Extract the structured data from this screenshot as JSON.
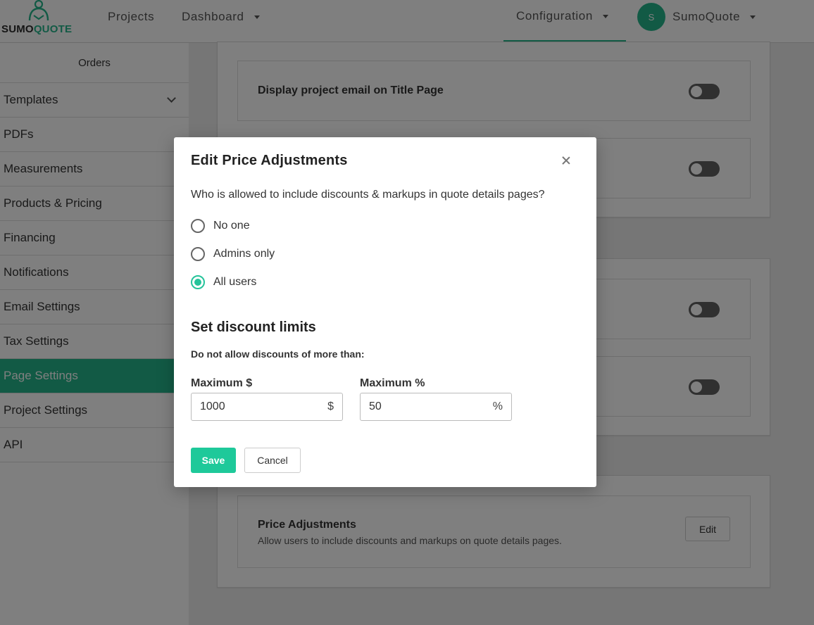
{
  "brand": {
    "name_part1": "SUMO",
    "name_part2": "QUOTE",
    "accent_color": "#25b48a"
  },
  "nav": {
    "projects": "Projects",
    "dashboard": "Dashboard",
    "configuration": "Configuration",
    "avatar_initial": "S",
    "account": "SumoQuote"
  },
  "sidebar": {
    "header": "Orders",
    "items": [
      {
        "label": "Templates",
        "expandable": true
      },
      {
        "label": "PDFs"
      },
      {
        "label": "Measurements"
      },
      {
        "label": "Products & Pricing"
      },
      {
        "label": "Financing"
      },
      {
        "label": "Notifications"
      },
      {
        "label": "Email Settings"
      },
      {
        "label": "Tax Settings"
      },
      {
        "label": "Page Settings",
        "active": true
      },
      {
        "label": "Project Settings"
      },
      {
        "label": "API"
      }
    ]
  },
  "main": {
    "cards": [
      {
        "title": "Display project email on Title Page",
        "toggle": false
      }
    ],
    "price_adjustments": {
      "title": "Price Adjustments",
      "description": "Allow users to include discounts and markups on quote details pages.",
      "edit_label": "Edit"
    }
  },
  "modal": {
    "title": "Edit Price Adjustments",
    "question": "Who is allowed to include discounts & markups in quote details pages?",
    "options": [
      {
        "label": "No one",
        "checked": false
      },
      {
        "label": "Admins only",
        "checked": false
      },
      {
        "label": "All users",
        "checked": true
      }
    ],
    "section_title": "Set discount limits",
    "sub_label": "Do not allow discounts of more than:",
    "max_dollar": {
      "label": "Maximum $",
      "value": "1000",
      "unit": "$"
    },
    "max_percent": {
      "label": "Maximum %",
      "value": "50",
      "unit": "%"
    },
    "save_label": "Save",
    "cancel_label": "Cancel"
  }
}
